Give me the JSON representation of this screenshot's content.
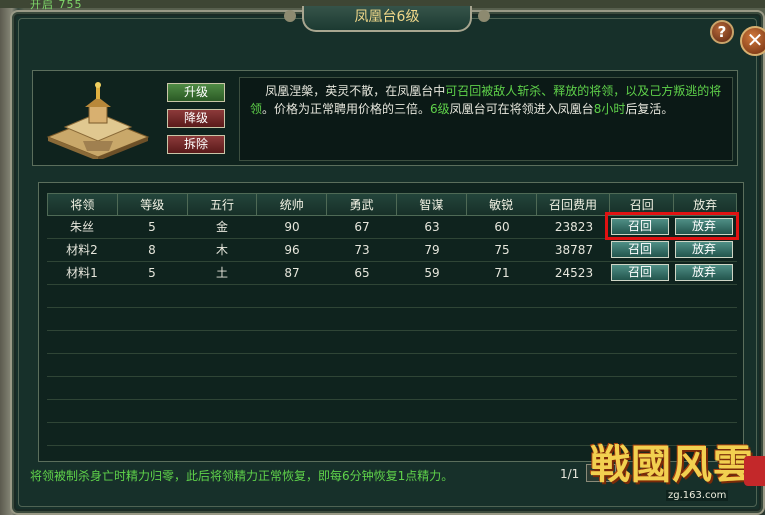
{
  "window": {
    "title": "凤凰台6级"
  },
  "top_strip": {
    "text": "开启 755"
  },
  "buttons": {
    "help": "?",
    "close": "✕",
    "upgrade": "升级",
    "downgrade": "降级",
    "demolish": "拆除"
  },
  "description": {
    "p1": "凤凰涅槃，英灵不散，在凤凰台中",
    "p1_green": "可召回被敌人斩杀、释放的将领，以及己方叛逃的将",
    "p2_green": "领",
    "p2": "。价格为正常聘用价格的三倍。",
    "p2_green2": "6级",
    "p3": "凤凰台可在将领进入凤凰台",
    "p3_green": "8小时",
    "p4": "后复活。"
  },
  "table": {
    "headers": [
      "将领",
      "等级",
      "五行",
      "统帅",
      "勇武",
      "智谋",
      "敏锐",
      "召回费用",
      "召回",
      "放弃"
    ],
    "rows": [
      {
        "name": "朱丝",
        "level": "5",
        "element": "金",
        "command": "90",
        "valor": "67",
        "wisdom": "63",
        "sharp": "60",
        "cost": "23823",
        "recall": "召回",
        "abandon": "放弃"
      },
      {
        "name": "材料2",
        "level": "8",
        "element": "木",
        "command": "96",
        "valor": "73",
        "wisdom": "79",
        "sharp": "75",
        "cost": "38787",
        "recall": "召回",
        "abandon": "放弃"
      },
      {
        "name": "材料1",
        "level": "5",
        "element": "土",
        "command": "87",
        "valor": "65",
        "wisdom": "59",
        "sharp": "71",
        "cost": "24523",
        "recall": "召回",
        "abandon": "放弃"
      }
    ]
  },
  "footer": {
    "note": "将领被制杀身亡时精力归零，此后将领精力正常恢复，即每6分钟恢复1点精力。",
    "page": "1/1"
  },
  "logo": {
    "text": "戦國风雲",
    "url": "zg.163.com"
  },
  "colors": {
    "accent_green": "#5fd24a",
    "highlight_red": "#e01212",
    "title_gold": "#f0d88a"
  }
}
